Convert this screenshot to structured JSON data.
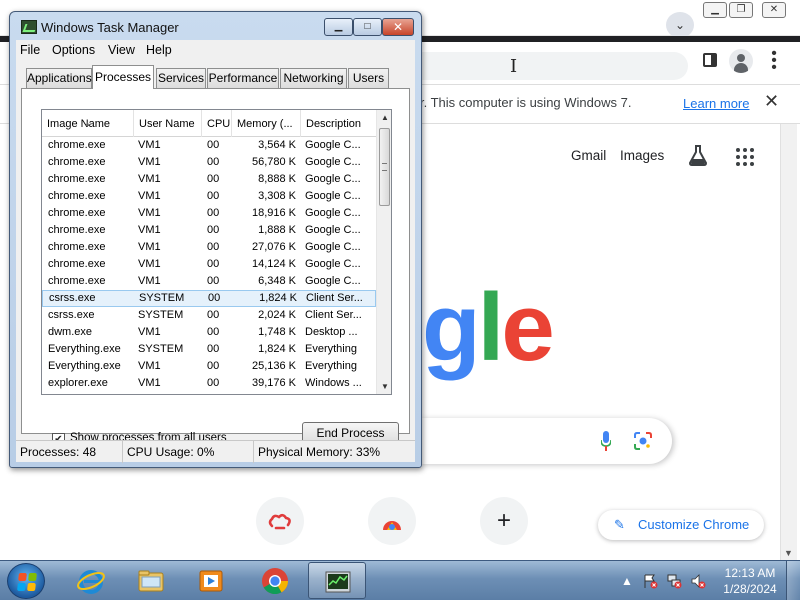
{
  "chrome": {
    "infobar_text": "r. This computer is using Windows 7.",
    "infobar_link": "Learn more",
    "close_glyph": "✕",
    "gmail": "Gmail",
    "images": "Images",
    "logo_letters": [
      {
        "ch": "g",
        "color": "#4285F4"
      },
      {
        "ch": "l",
        "color": "#34A853"
      },
      {
        "ch": "e",
        "color": "#EA4335"
      }
    ],
    "customize_label": "Customize Chrome",
    "add_shortcut_glyph": "+",
    "colors": {
      "accent": "#1a73e8"
    }
  },
  "taskmgr": {
    "title": "Windows Task Manager",
    "controls": {
      "minimize": "▁",
      "maximize": "□",
      "close": "✕"
    },
    "menus": [
      "File",
      "Options",
      "View",
      "Help"
    ],
    "tabs": [
      "Applications",
      "Processes",
      "Services",
      "Performance",
      "Networking",
      "Users"
    ],
    "active_tab": "Processes",
    "columns": [
      "Image Name",
      "User Name",
      "CPU",
      "Memory (...",
      "Description"
    ],
    "rows": [
      {
        "name": "chrome.exe",
        "user": "VM1",
        "cpu": "00",
        "mem": "3,564 K",
        "desc": "Google C..."
      },
      {
        "name": "chrome.exe",
        "user": "VM1",
        "cpu": "00",
        "mem": "56,780 K",
        "desc": "Google C..."
      },
      {
        "name": "chrome.exe",
        "user": "VM1",
        "cpu": "00",
        "mem": "8,888 K",
        "desc": "Google C..."
      },
      {
        "name": "chrome.exe",
        "user": "VM1",
        "cpu": "00",
        "mem": "3,308 K",
        "desc": "Google C..."
      },
      {
        "name": "chrome.exe",
        "user": "VM1",
        "cpu": "00",
        "mem": "18,916 K",
        "desc": "Google C..."
      },
      {
        "name": "chrome.exe",
        "user": "VM1",
        "cpu": "00",
        "mem": "1,888 K",
        "desc": "Google C..."
      },
      {
        "name": "chrome.exe",
        "user": "VM1",
        "cpu": "00",
        "mem": "27,076 K",
        "desc": "Google C..."
      },
      {
        "name": "chrome.exe",
        "user": "VM1",
        "cpu": "00",
        "mem": "14,124 K",
        "desc": "Google C..."
      },
      {
        "name": "chrome.exe",
        "user": "VM1",
        "cpu": "00",
        "mem": "6,348 K",
        "desc": "Google C..."
      },
      {
        "name": "csrss.exe",
        "user": "SYSTEM",
        "cpu": "00",
        "mem": "1,824 K",
        "desc": "Client Ser...",
        "selected": true
      },
      {
        "name": "csrss.exe",
        "user": "SYSTEM",
        "cpu": "00",
        "mem": "2,024 K",
        "desc": "Client Ser..."
      },
      {
        "name": "dwm.exe",
        "user": "VM1",
        "cpu": "00",
        "mem": "1,748 K",
        "desc": "Desktop ..."
      },
      {
        "name": "Everything.exe",
        "user": "SYSTEM",
        "cpu": "00",
        "mem": "1,824 K",
        "desc": "Everything"
      },
      {
        "name": "Everything.exe",
        "user": "VM1",
        "cpu": "00",
        "mem": "25,136 K",
        "desc": "Everything"
      },
      {
        "name": "explorer.exe",
        "user": "VM1",
        "cpu": "00",
        "mem": "39,176 K",
        "desc": "Windows ..."
      }
    ],
    "show_all_label": "Show processes from all users",
    "show_all_checked": true,
    "end_process_label": "End Process",
    "status": {
      "processes": "Processes: 48",
      "cpu": "CPU Usage: 0%",
      "memory": "Physical Memory: 33%"
    }
  },
  "taskbar": {
    "time": "12:13 AM",
    "date": "1/28/2024",
    "items": [
      "internet-explorer",
      "file-explorer",
      "media-player",
      "chrome",
      "task-manager"
    ],
    "active_item": "task-manager"
  }
}
